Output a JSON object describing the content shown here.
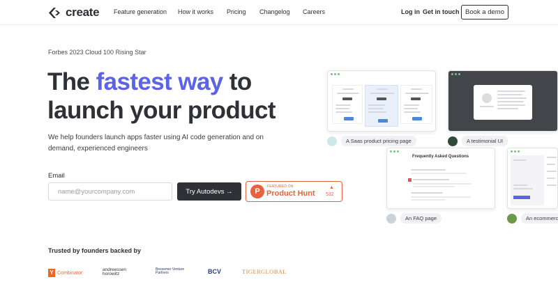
{
  "brand": {
    "name": "create"
  },
  "nav": {
    "links": [
      "Feature generation",
      "How it works",
      "Pricing",
      "Changelog",
      "Careers"
    ],
    "login": "Log in",
    "get_in_touch": "Get in touch",
    "book_demo": "Book a demo"
  },
  "hero": {
    "eyebrow": "Forbes 2023 Cloud 100 Rising Star",
    "headline_part1": "The ",
    "headline_accent": "fastest way",
    "headline_part2": " to launch your product",
    "subtitle": "We help founders launch apps faster using AI code generation and on demand, experienced engineers",
    "email_label": "Email",
    "email_placeholder": "name@yourcompany.com",
    "cta": "Try Autodevs →"
  },
  "product_hunt": {
    "small": "FEATURED ON",
    "name": "Product Hunt",
    "count": "532"
  },
  "trusted": {
    "label": "Trusted by founders backed by",
    "investors": [
      "Combinator",
      "andreessen horowitz",
      "Bessemer Venture Partners",
      "BCV",
      "TIGERGLOBAL"
    ]
  },
  "cards": [
    {
      "caption": "A Saas product pricing page"
    },
    {
      "caption": "A testimonial UI"
    },
    {
      "caption": "An FAQ page",
      "title": "Frequently Asked Questions"
    },
    {
      "caption": "An ecommerce page"
    }
  ],
  "colors": {
    "accent": "#5b63e6",
    "dark": "#2f3137",
    "product_hunt": "#e8623f"
  }
}
